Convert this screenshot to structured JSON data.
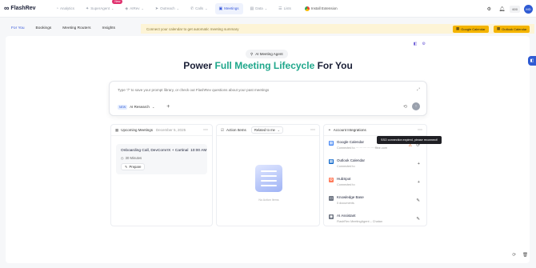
{
  "app": {
    "name": "FlashRev"
  },
  "nav": {
    "items": [
      {
        "label": "Analytics",
        "icon": "analytics-icon",
        "glyph": "◔",
        "chevron": false
      },
      {
        "label": "SuperAgent",
        "icon": "superagent-icon",
        "glyph": "✦",
        "chevron": true,
        "badge": "New"
      },
      {
        "label": "AIRev",
        "icon": "airev-icon",
        "glyph": "◈",
        "chevron": true
      },
      {
        "label": "Outreach",
        "icon": "outreach-icon",
        "glyph": "➤",
        "chevron": true
      },
      {
        "label": "Calls",
        "icon": "phone-icon",
        "glyph": "✆",
        "chevron": true
      },
      {
        "label": "Meetings",
        "icon": "meetings-icon",
        "glyph": "▣",
        "chevron": false,
        "active": true
      },
      {
        "label": "Data",
        "icon": "data-icon",
        "glyph": "▤",
        "chevron": true
      },
      {
        "label": "Lists",
        "icon": "lists-icon",
        "glyph": "☰",
        "chevron": false
      }
    ],
    "install_extension": "Install Extension",
    "credit": "600",
    "avatar": "MD"
  },
  "subnav": {
    "tabs": [
      "For You",
      "Bookings",
      "Meeting Routers",
      "Insights"
    ],
    "banner": "Connect your calendar to get automatic meeting summary",
    "google_calendar_btn": "Google Calendar",
    "outlook_calendar_btn": "Outlook Calendar"
  },
  "hero": {
    "agent_pill": "AI Meeting Agent",
    "headline_pre": "Power ",
    "headline_accent": "Full Meeting Lifecycle",
    "headline_post": " For You"
  },
  "prompt": {
    "placeholder": "Type \"/\" to save your prompt library, or check out FlashRev questions about your past meetings",
    "new_tag": "NEW",
    "mode": "AI Research"
  },
  "upcoming": {
    "title": "Upcoming Meetings",
    "date": "December 5, 2025",
    "meeting_title": "Onboarding Call, DevComrrX + Cartinal",
    "meeting_time": "10:00 AM",
    "duration": "30 Minutes",
    "prepare": "Prepare"
  },
  "actions": {
    "title": "Action Items",
    "filter": "Related to me",
    "empty": "No Action Items"
  },
  "integrations": {
    "title": "Account Integrations",
    "tooltip": "SSO connection expired, please reconnect!",
    "items": [
      {
        "name": "Google Calendar",
        "sub": "Connected to ···················ffine.com",
        "icon": "google-calendar-icon",
        "glyph": "▦",
        "color": "#4285f4",
        "action": "refresh-icon",
        "action_glyph": "⟳",
        "warning": true
      },
      {
        "name": "Outlook Calendar",
        "sub": "Connected to",
        "icon": "outlook-calendar-icon",
        "glyph": "▦",
        "color": "#0a64c9",
        "action": "add-icon",
        "action_glyph": "+",
        "warning": false
      },
      {
        "name": "HubSpot",
        "sub": "Connected to",
        "icon": "hubspot-icon",
        "glyph": "⚙",
        "color": "#ff7a59",
        "action": "add-icon",
        "action_glyph": "+",
        "warning": false
      },
      {
        "name": "Knowledge Base",
        "sub": "0 documents",
        "icon": "knowledge-base-icon",
        "glyph": "▭",
        "color": "#6b7280",
        "action": "edit-icon",
        "action_glyph": "✎",
        "warning": false
      },
      {
        "name": "AI Assistant",
        "sub": "FlashRev MeetingAgent – Chatan",
        "icon": "ai-assistant-icon",
        "glyph": "◉",
        "color": "#6b7280",
        "action": "edit-icon",
        "action_glyph": "✎",
        "warning": false
      }
    ]
  }
}
